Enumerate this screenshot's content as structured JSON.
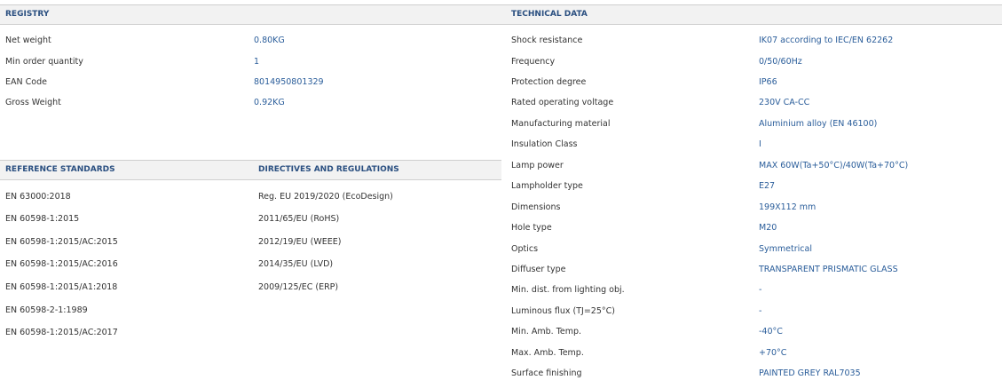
{
  "registry": {
    "header": "REGISTRY",
    "rows": [
      {
        "label": "Net weight",
        "value": "0.80KG"
      },
      {
        "label": "Min order quantity",
        "value": "1"
      },
      {
        "label": "EAN Code",
        "value": "8014950801329"
      },
      {
        "label": "Gross Weight",
        "value": "0.92KG"
      }
    ]
  },
  "technical_data": {
    "header": "TECHNICAL DATA",
    "rows": [
      {
        "label": "Shock resistance",
        "value": "IK07 according to IEC/EN 62262"
      },
      {
        "label": "Frequency",
        "value": "0/50/60Hz"
      },
      {
        "label": "Protection degree",
        "value": "IP66"
      },
      {
        "label": "Rated operating voltage",
        "value": "230V CA-CC"
      },
      {
        "label": "Manufacturing material",
        "value": "Aluminium alloy (EN 46100)"
      },
      {
        "label": "Insulation Class",
        "value": "I"
      },
      {
        "label": "Lamp power",
        "value": "MAX 60W(Ta+50°C)/40W(Ta+70°C)"
      },
      {
        "label": "Lampholder type",
        "value": "E27"
      },
      {
        "label": "Dimensions",
        "value": "199X112 mm"
      },
      {
        "label": "Hole type",
        "value": "M20"
      },
      {
        "label": "Optics",
        "value": "Symmetrical"
      },
      {
        "label": "Diffuser type",
        "value": "TRANSPARENT PRISMATIC GLASS"
      },
      {
        "label": "Min. dist. from lighting obj.",
        "value": "-"
      },
      {
        "label": "Luminous flux (TJ=25°C)",
        "value": "-"
      },
      {
        "label": "Min. Amb. Temp.",
        "value": "-40°C"
      },
      {
        "label": "Max. Amb. Temp.",
        "value": "+70°C"
      },
      {
        "label": "Surface finishing",
        "value": "PAINTED GREY RAL7035"
      }
    ]
  },
  "reference_standards": {
    "header": "REFERENCE STANDARDS",
    "items": [
      "EN 63000:2018",
      "EN 60598-1:2015",
      "EN 60598-1:2015/AC:2015",
      "EN 60598-1:2015/AC:2016",
      "EN 60598-1:2015/A1:2018",
      "EN 60598-2-1:1989",
      "EN 60598-1:2015/AC:2017"
    ]
  },
  "directives": {
    "header": "DIRECTIVES AND REGULATIONS",
    "items": [
      "Reg. EU 2019/2020 (EcoDesign)",
      "2011/65/EU (RoHS)",
      "2012/19/EU (WEEE)",
      "2014/35/EU (LVD)",
      "2009/125/EC (ERP)"
    ]
  },
  "colors": {
    "header_text": "#2a4f80",
    "value_text": "#2a5d9a",
    "header_bg": "#f2f2f2"
  }
}
